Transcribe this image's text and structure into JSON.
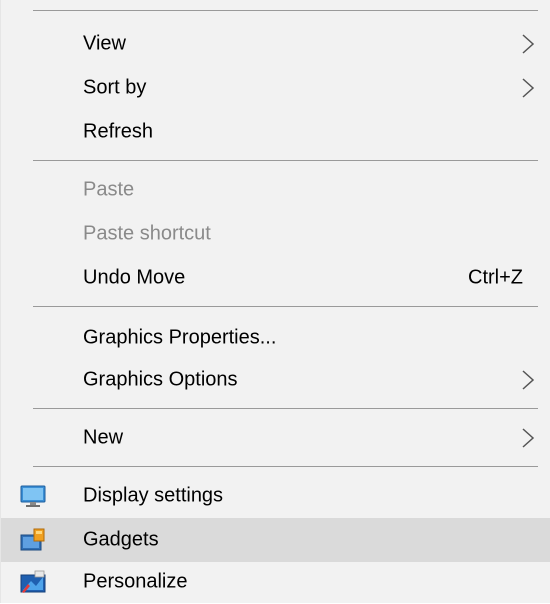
{
  "menu": {
    "items": [
      {
        "label": "View",
        "submenu": true
      },
      {
        "label": "Sort by",
        "submenu": true
      },
      {
        "label": "Refresh"
      },
      {
        "label": "Paste",
        "disabled": true
      },
      {
        "label": "Paste shortcut",
        "disabled": true
      },
      {
        "label": "Undo Move",
        "shortcut": "Ctrl+Z"
      },
      {
        "label": "Graphics Properties..."
      },
      {
        "label": "Graphics Options",
        "submenu": true
      },
      {
        "label": "New",
        "submenu": true
      },
      {
        "label": "Display settings",
        "icon": "display-settings-icon"
      },
      {
        "label": "Gadgets",
        "icon": "gadgets-icon",
        "highlighted": true
      },
      {
        "label": "Personalize",
        "icon": "personalize-icon"
      }
    ]
  },
  "colors": {
    "menu_background": "#f2f2f2",
    "hover_background": "#dadada",
    "separator": "#9a9a9a",
    "disabled_text": "#8a8a8a"
  }
}
